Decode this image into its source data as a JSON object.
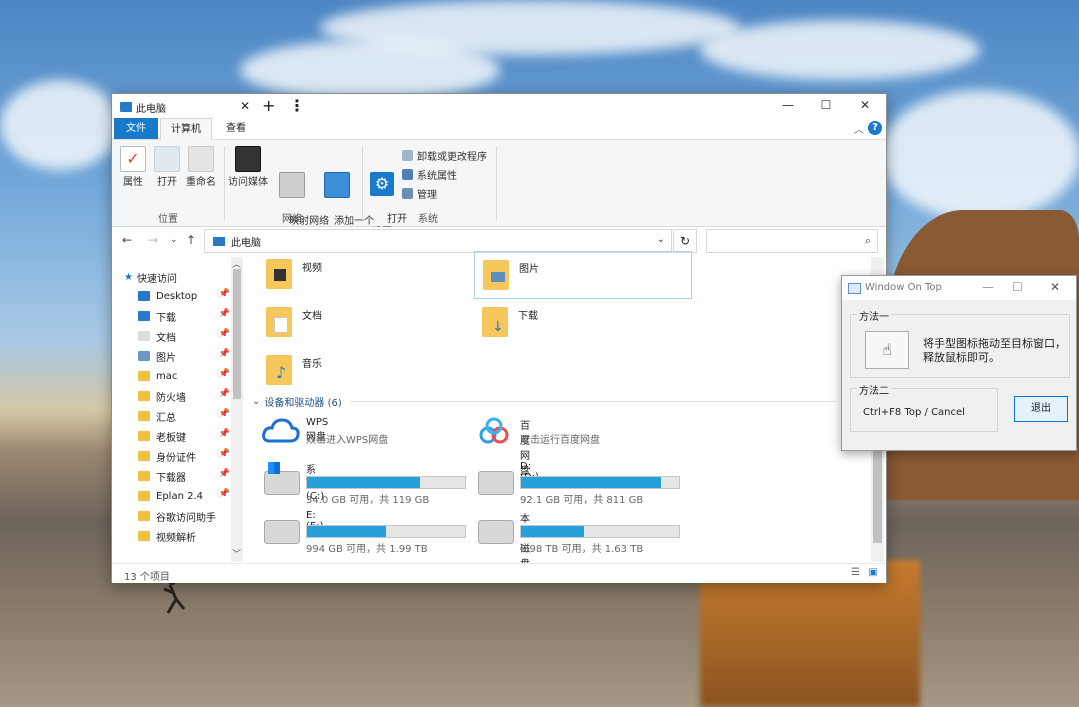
{
  "explorer": {
    "tab_title": "此电脑",
    "ribbon_tabs": [
      "文件",
      "计算机",
      "查看"
    ],
    "ribbon": {
      "location_group": {
        "label": "位置",
        "buttons": [
          "属性",
          "打开",
          "重命名"
        ]
      },
      "network_group": {
        "label": "网络",
        "buttons": [
          "访问媒体",
          "映射网络\n驱动器",
          "添加一个\n网络位置"
        ]
      },
      "system_group": {
        "label": "系统",
        "open_settings": "打开\n设置",
        "items": [
          "卸载或更改程序",
          "系统属性",
          "管理"
        ]
      }
    },
    "address": {
      "path": "此电脑"
    },
    "nav": {
      "quick_access": "快速访问",
      "items": [
        "Desktop",
        "下载",
        "文档",
        "图片",
        "mac",
        "防火墙",
        "汇总",
        "老板键",
        "身份证件",
        "下载器",
        "Eplan 2.4",
        "谷歌访问助手",
        "视频解析"
      ]
    },
    "folders": [
      "视频",
      "图片",
      "文档",
      "下载",
      "音乐"
    ],
    "devices_section": "设备和驱动器 (6)",
    "apps": [
      {
        "name": "WPS网盘",
        "desc": "双击进入WPS网盘"
      },
      {
        "name": "百度网盘",
        "desc": "双击运行百度网盘"
      }
    ],
    "drives": [
      {
        "name": "系统 (C:)",
        "caption": "34.0 GB 可用，共 119 GB",
        "used_fraction": 0.714
      },
      {
        "name": "D: (D:)",
        "caption": "92.1 GB 可用，共 811 GB",
        "used_fraction": 0.886
      },
      {
        "name": "E:  (E:)",
        "caption": "994 GB 可用，共 1.99 TB",
        "used_fraction": 0.5
      },
      {
        "name": "本地磁盘 (F:)",
        "caption": "0.98 TB 可用，共 1.63 TB",
        "used_fraction": 0.4
      }
    ],
    "status": "13 个项目"
  },
  "window_on_top": {
    "title": "Window On Top",
    "method1_label": "方法一",
    "method1_text": "将手型图标拖动至目标窗口，释放鼠标即可。",
    "method2_label": "方法二",
    "method2_text": "Ctrl+F8  Top / Cancel",
    "exit_label": "退出"
  }
}
